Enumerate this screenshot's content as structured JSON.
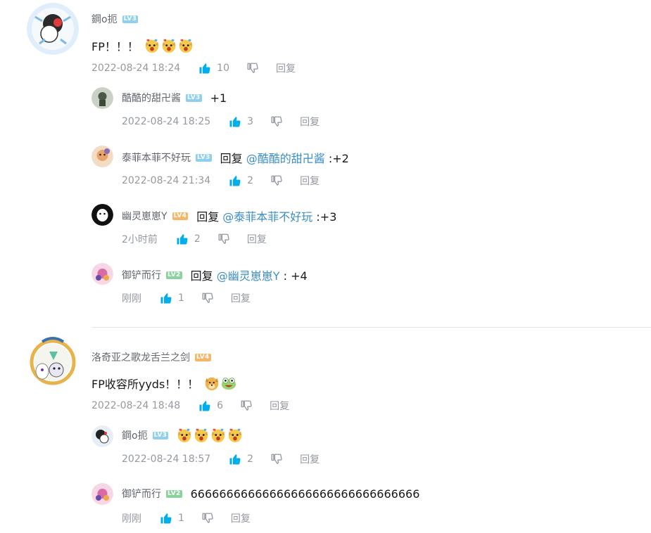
{
  "colors": {
    "accent_blue": "#00aeec",
    "mention_blue": "#3c8ec7",
    "meta_gray": "#9499a0",
    "name_gray": "#61666d"
  },
  "comments": [
    {
      "user": "鋼o扼",
      "level": "LV3",
      "content": "FP！！！",
      "emojis": [
        "surprised-dog-emoji",
        "surprised-dog-emoji",
        "surprised-dog-emoji"
      ],
      "time": "2022-08-24 18:24",
      "likes": "10",
      "reply_label": "回复",
      "replies": [
        {
          "user": "酷酷的甜卍酱",
          "level": "LV3",
          "content": "+1",
          "time": "2022-08-24 18:25",
          "likes": "3",
          "reply_label": "回复"
        },
        {
          "user": "泰菲本菲不好玩",
          "level": "LV3",
          "prefix": "回复",
          "mention": "@酷酷的甜卍酱",
          "suffix": " :+2",
          "time": "2022-08-24 21:34",
          "likes": "2",
          "reply_label": "回复"
        },
        {
          "user": "幽灵崽崽Y",
          "level": "LV4",
          "prefix": "回复",
          "mention": "@泰菲本菲不好玩",
          "suffix": " :+3",
          "time": "2小时前",
          "likes": "2",
          "reply_label": "回复"
        },
        {
          "user": "御铲而行",
          "level": "LV2",
          "prefix": "回复",
          "mention": "@幽灵崽崽Y",
          "suffix": " : +4",
          "time": "刚刚",
          "likes": "1",
          "reply_label": "回复"
        }
      ]
    },
    {
      "user": "洛奇亚之歌龙舌兰之剑",
      "level": "LV4",
      "content": "FP收容所yyds！！！",
      "emojis": [
        "doge-emoji",
        "laughing-emoji"
      ],
      "time": "2022-08-24 18:48",
      "likes": "6",
      "reply_label": "回复",
      "replies": [
        {
          "user": "鋼o扼",
          "level": "LV3",
          "content": "",
          "emojis": [
            "surprised-dog-emoji",
            "surprised-dog-emoji",
            "surprised-dog-emoji",
            "surprised-dog-emoji"
          ],
          "time": "2022-08-24 18:57",
          "likes": "2",
          "reply_label": "回复"
        },
        {
          "user": "御铲而行",
          "level": "LV2",
          "content": "66666666666666666666666666666666",
          "time": "刚刚",
          "likes": "1",
          "reply_label": "回复"
        }
      ]
    }
  ],
  "icons": {
    "like": "thumbs-up-icon",
    "dislike": "thumbs-down-icon"
  }
}
